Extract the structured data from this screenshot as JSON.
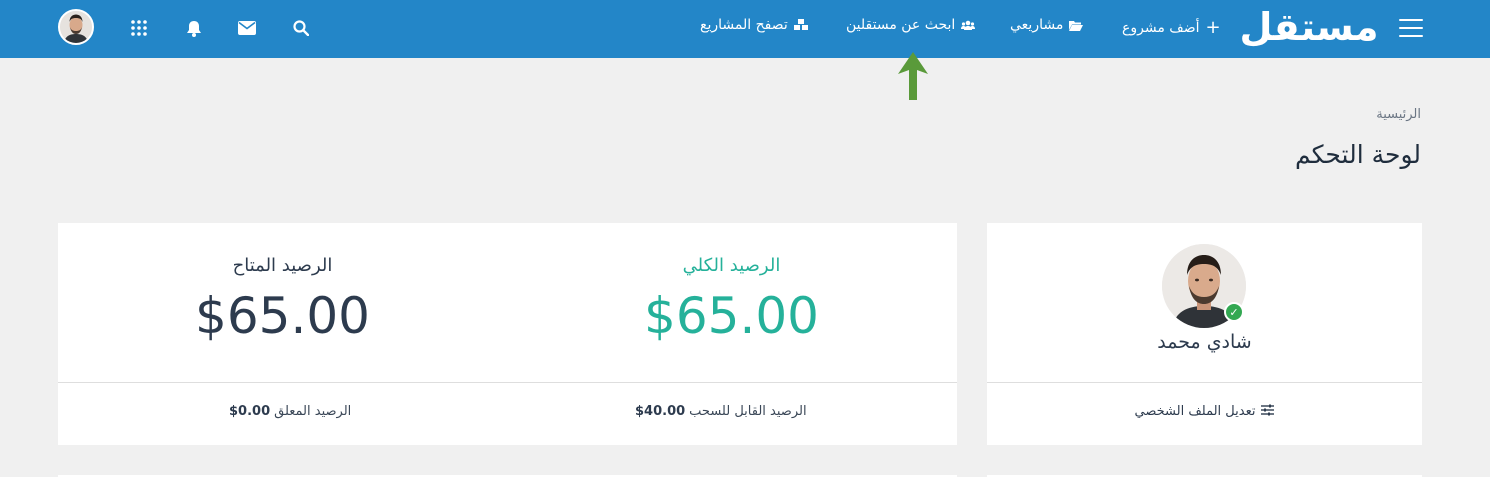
{
  "brand": {
    "logo": "مستقل",
    "primary_color": "#2386c8",
    "accent_green": "#25b19a"
  },
  "nav": {
    "menu_icon": "hamburger-menu-icon",
    "add_project": {
      "label": "أضف مشروع",
      "icon": "plus-icon"
    },
    "my_projects": {
      "label": "مشاريعي",
      "icon": "folder-open-icon"
    },
    "find_freelancers": {
      "label": "ابحث عن مستقلين",
      "icon": "users-icon"
    },
    "browse_projects": {
      "label": "تصفح المشاريع",
      "icon": "cubes-icon"
    },
    "icons": [
      "search-icon",
      "envelope-icon",
      "bell-icon",
      "apps-grid-icon"
    ],
    "avatar": "user-avatar"
  },
  "header": {
    "breadcrumb": "الرئيسية",
    "title": "لوحة التحكم"
  },
  "balance": {
    "total_label": "الرصيد الكلي",
    "total_value": "$65.00",
    "available_label": "الرصيد المتاح",
    "available_value": "$65.00",
    "withdrawable_label": "الرصيد القابل للسحب",
    "withdrawable_value": "$40.00",
    "pending_label": "الرصيد المعلق",
    "pending_value": "$0.00"
  },
  "profile": {
    "name": "شادي محمد",
    "verified_icon": "check-icon",
    "edit_label": "تعديل الملف الشخصي",
    "edit_icon": "sliders-icon"
  }
}
